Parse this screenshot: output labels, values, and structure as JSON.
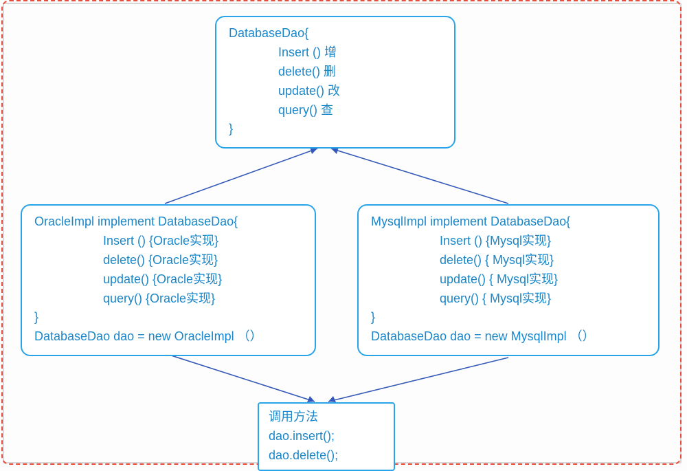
{
  "colors": {
    "box_border": "#2aa4e8",
    "text": "#1b87c9",
    "frame": "#e74c3c",
    "connector": "#3559b8"
  },
  "top_box": {
    "header": "DatabaseDao{",
    "m1": "Insert ()   增",
    "m2": "delete()   删",
    "m3": "update()  改",
    "m4": "query()    查",
    "close": "}"
  },
  "left_box": {
    "header": "OracleImpl implement DatabaseDao{",
    "m1": "Insert ()   {Oracle实现}",
    "m2": "delete()   {Oracle实现}",
    "m3": "update()  {Oracle实现}",
    "m4": "query()   {Oracle实现}",
    "close": "}",
    "decl": "DatabaseDao dao = new OracleImpl （）"
  },
  "right_box": {
    "header": "MysqlImpl implement DatabaseDao{",
    "m1": "Insert ()   {Mysql实现}",
    "m2": "delete()   { Mysql实现}",
    "m3": "update()  { Mysql实现}",
    "m4": "query()   { Mysql实现}",
    "close": "}",
    "decl": "DatabaseDao dao = new MysqlImpl （）"
  },
  "bottom_box": {
    "l1": "调用方法",
    "l2": "dao.insert();",
    "l3": "dao.delete();"
  }
}
